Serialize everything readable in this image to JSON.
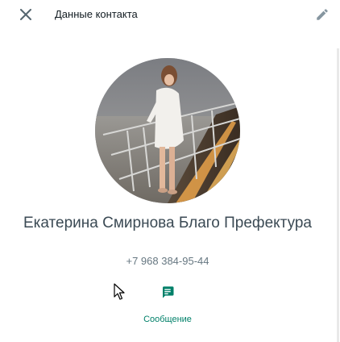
{
  "header": {
    "title": "Данные контакта",
    "close_icon": "close-icon",
    "edit_icon": "pencil-icon"
  },
  "contact": {
    "name": "Екатерина Смирнова Благо Префектура",
    "phone": "+7 968 384-95-44",
    "avatar": "profile-photo"
  },
  "actions": {
    "message_label": "Сообщение",
    "message_icon": "message-icon"
  },
  "colors": {
    "accent": "#008069",
    "icon": "#54656f",
    "name": "#3b4a54",
    "secondary": "#667781"
  }
}
